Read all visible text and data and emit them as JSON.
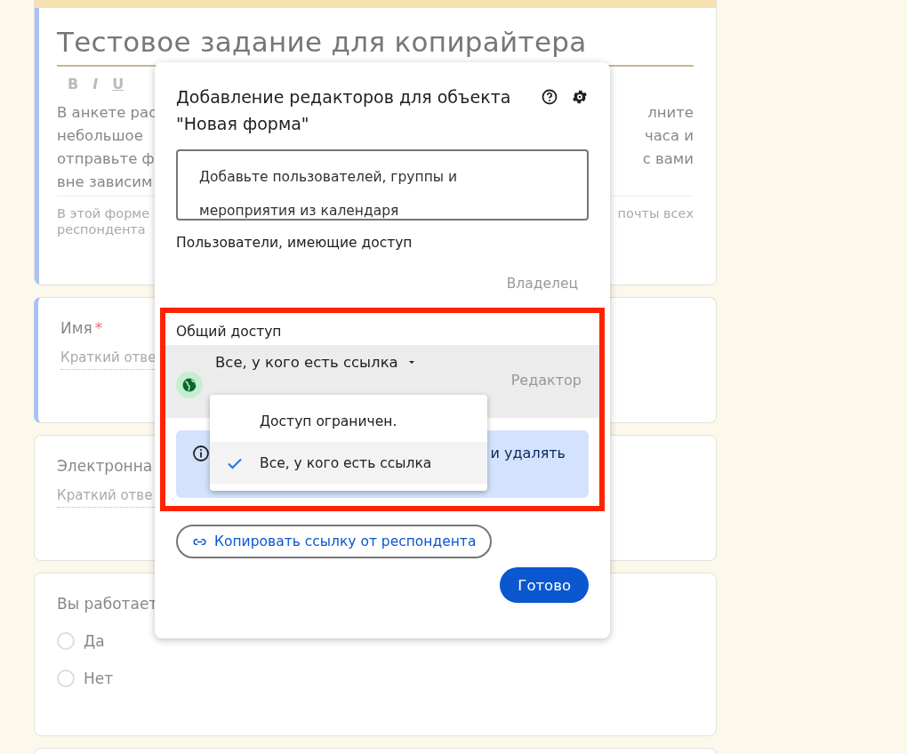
{
  "form": {
    "title": "Тестовое задание для копирайтера",
    "toolbar": [
      "B",
      "I",
      "U"
    ],
    "description_lines": [
      {
        "left": "В анкете рас",
        "right": "лните"
      },
      {
        "left": "небольшое",
        "right": "часа и"
      },
      {
        "left": "отправьте ф",
        "right": "с вами"
      },
      {
        "left": "вне зависим"
      }
    ],
    "note_lines": [
      {
        "left": "В этой форме",
        "right": "почты всех"
      },
      {
        "left": "респондента"
      }
    ],
    "questions": [
      {
        "kind": "short",
        "label": "Имя",
        "required_mark": "*",
        "selected": true,
        "placeholder": "Краткий отве"
      },
      {
        "kind": "short",
        "label": "Электронна",
        "selected": false,
        "placeholder": "Краткий отве"
      },
      {
        "kind": "choice",
        "label": "Вы работает",
        "selected": false,
        "options": [
          {
            "label": "Да",
            "checked": false
          },
          {
            "label": "Нет",
            "checked": false
          }
        ]
      }
    ]
  },
  "dialog": {
    "title": "Добавление редакторов для объекта \"Новая форма\"",
    "search": {
      "placeholder": "Добавьте пользователей, группы и мероприятия из календаря"
    },
    "people_heading": "Пользователи, имеющие доступ",
    "owner_role": "Владелец",
    "general_access": {
      "heading": "Общий доступ",
      "value": "Все, у кого есть ссылка",
      "role": "Редактор",
      "info_text": "и удалять",
      "menu": [
        {
          "label": "Доступ ограничен.",
          "selected": false
        },
        {
          "label": "Все, у кого есть ссылка",
          "selected": true
        }
      ]
    },
    "copy_link": "Копировать ссылку от респондента",
    "done": "Готово"
  }
}
